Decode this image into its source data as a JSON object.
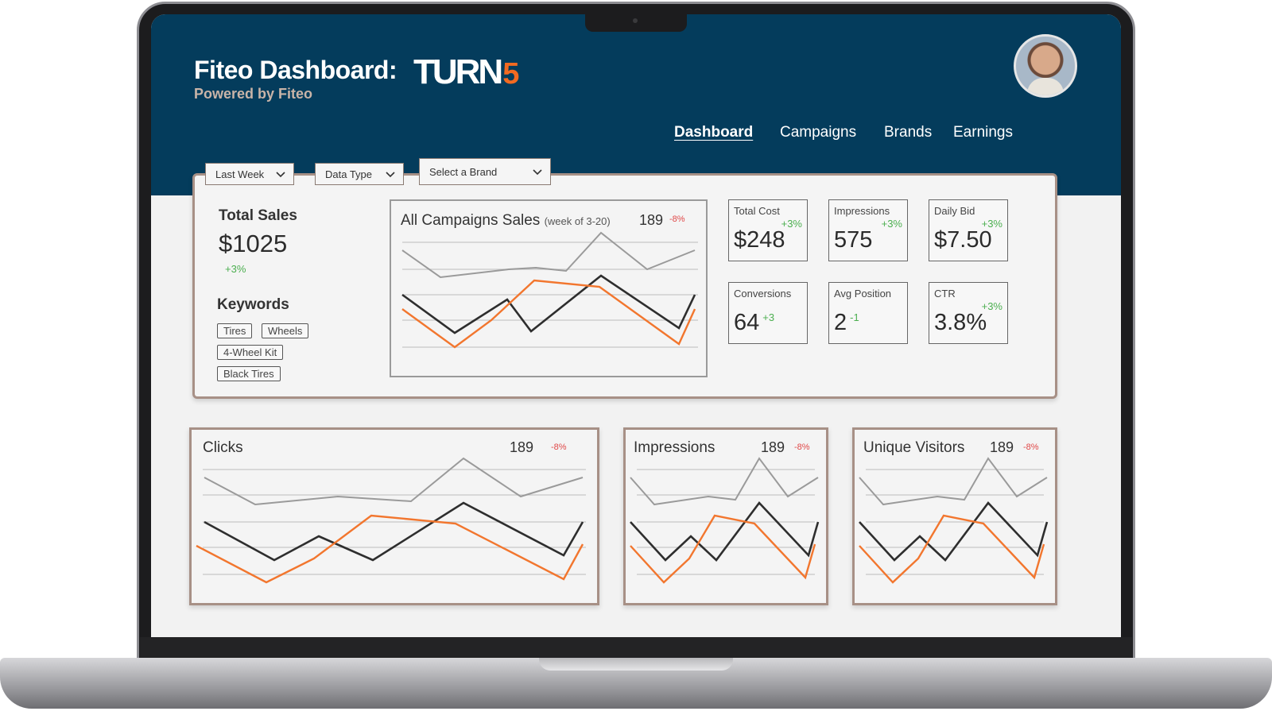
{
  "header": {
    "title": "Fiteo Dashboard:",
    "subtitle": "Powered by Fiteo",
    "brand_logo_text": "TURN",
    "brand_logo_number": "5",
    "brand_color": "#f26a21",
    "header_color": "#043c5c"
  },
  "nav": [
    {
      "label": "Dashboard",
      "active": true
    },
    {
      "label": "Campaigns",
      "active": false
    },
    {
      "label": "Brands",
      "active": false
    },
    {
      "label": "Earnings",
      "active": false
    }
  ],
  "filters": {
    "date_range": "Last Week",
    "data_type": "Data Type",
    "brand": "Select a Brand"
  },
  "summary": {
    "total_sales_label": "Total Sales",
    "total_sales_value": "$1025",
    "total_sales_change": "+3%",
    "keywords_label": "Keywords",
    "keywords": [
      "Tires",
      "Wheels",
      "4-Wheel Kit",
      "Black Tires"
    ]
  },
  "main_chart": {
    "title": "All Campaigns Sales",
    "subtitle": "(week of 3-20)",
    "value": "189",
    "change": "-8%"
  },
  "metrics": [
    {
      "label": "Total Cost",
      "value": "$248",
      "change": "+3%"
    },
    {
      "label": "Impressions",
      "value": "575",
      "change": "+3%"
    },
    {
      "label": "Daily Bid",
      "value": "$7.50",
      "change": "+3%"
    },
    {
      "label": "Conversions",
      "value": "64",
      "change": "+3"
    },
    {
      "label": "Avg Position",
      "value": "2",
      "change": "-1"
    },
    {
      "label": "CTR",
      "value": "3.8%",
      "change": "+3%"
    }
  ],
  "bottom_charts": [
    {
      "title": "Clicks",
      "value": "189",
      "change": "-8%"
    },
    {
      "title": "Impressions",
      "value": "189",
      "change": "-8%"
    },
    {
      "title": "Unique Visitors",
      "value": "189",
      "change": "-8%"
    }
  ],
  "colors": {
    "positive": "#4caf50",
    "negative": "#e04848",
    "series_gray": "#9a9a9a",
    "series_dark": "#2e2e2e",
    "series_orange": "#f2762e"
  }
}
